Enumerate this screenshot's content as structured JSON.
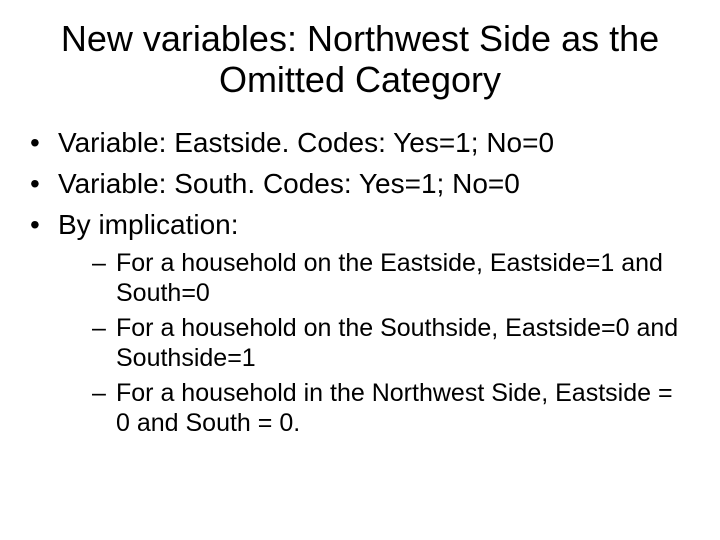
{
  "title": "New variables:  Northwest Side as the Omitted Category",
  "bullets": {
    "b0": "Variable:  Eastside.  Codes: Yes=1; No=0",
    "b1": "Variable:  South. Codes: Yes=1; No=0",
    "b2": "By implication:",
    "sub": {
      "s0": "For a household on the Eastside, Eastside=1 and South=0",
      "s1": "For a household on the Southside, Eastside=0 and Southside=1",
      "s2": "For a household in the Northwest Side, Eastside = 0 and South = 0."
    }
  }
}
